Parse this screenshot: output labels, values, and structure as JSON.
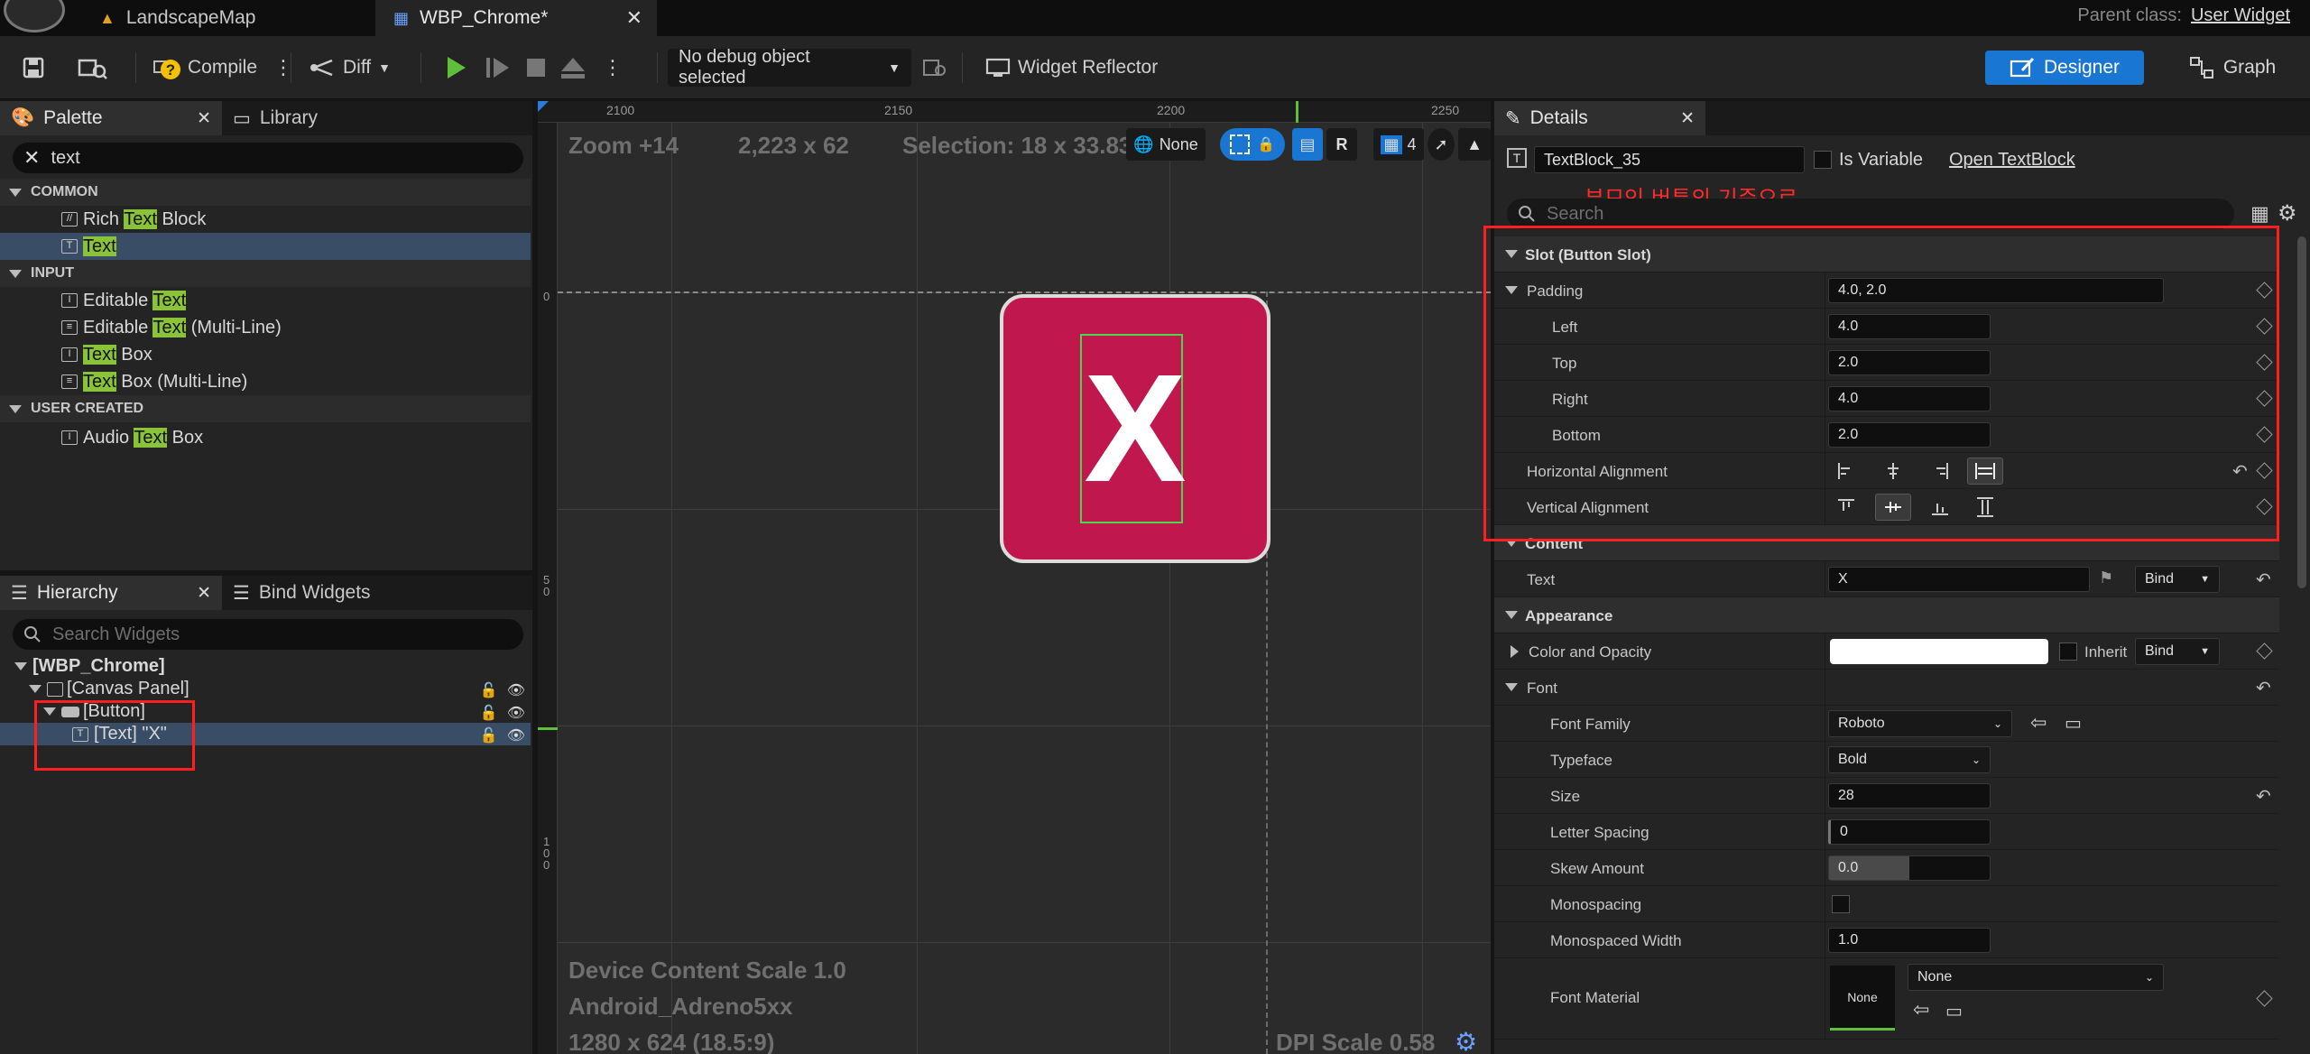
{
  "tabs": [
    {
      "label": "LandscapeMap",
      "active": false
    },
    {
      "label": "WBP_Chrome*",
      "active": true
    }
  ],
  "parent_class": {
    "label": "Parent class:",
    "value": "User Widget"
  },
  "toolbar": {
    "compile": "Compile",
    "diff": "Diff",
    "debug_object": "No debug object selected",
    "widget_reflector": "Widget Reflector",
    "designer": "Designer",
    "graph": "Graph"
  },
  "palette": {
    "tab_label": "Palette",
    "library_tab": "Library",
    "search_value": "text",
    "categories": [
      {
        "name": "COMMON",
        "items": [
          {
            "pre": "Rich ",
            "hl": "Text",
            "post": " Block",
            "selected": false
          },
          {
            "pre": "",
            "hl": "Text",
            "post": "",
            "selected": true
          }
        ]
      },
      {
        "name": "INPUT",
        "items": [
          {
            "pre": "Editable ",
            "hl": "Text",
            "post": ""
          },
          {
            "pre": "Editable ",
            "hl": "Text",
            "post": " (Multi-Line)"
          },
          {
            "pre": "",
            "hl": "Text",
            "post": " Box"
          },
          {
            "pre": "",
            "hl": "Text",
            "post": " Box (Multi-Line)"
          }
        ]
      },
      {
        "name": "USER CREATED",
        "items": [
          {
            "pre": "Audio ",
            "hl": "Text",
            "post": " Box"
          }
        ]
      }
    ]
  },
  "hierarchy": {
    "tab_label": "Hierarchy",
    "bind_tab": "Bind Widgets",
    "search_placeholder": "Search Widgets",
    "root": "[WBP_Chrome]",
    "canvas_panel": "[Canvas Panel]",
    "button": "[Button]",
    "text_item": "[Text] \"X\""
  },
  "canvas": {
    "zoom": "Zoom +14",
    "resolution": "2,223 x 62",
    "selection": "Selection: 18 x 33.83",
    "none_label": "None",
    "r_label": "R",
    "grid_count": "4",
    "ruler_h": [
      "2100",
      "2150",
      "2200",
      "2250"
    ],
    "ruler_v": [
      "0",
      "5\n0",
      "1\n0\n0"
    ],
    "button_text": "X",
    "device_scale": "Device Content Scale 1.0",
    "device_name": "Android_Adreno5xx",
    "device_res": "1280 x 624 (18.5:9)",
    "dpi_scale": "DPI Scale 0.58",
    "button_color": "#c0174e"
  },
  "details": {
    "tab_label": "Details",
    "widget_name": "TextBlock_35",
    "is_variable": "Is Variable",
    "open_link": "Open TextBlock",
    "annotation": "부모인 버튼의 기준으로",
    "search_placeholder": "Search",
    "slot_section": "Slot (Button Slot)",
    "padding": {
      "label": "Padding",
      "value": "4.0, 2.0"
    },
    "left": {
      "label": "Left",
      "value": "4.0"
    },
    "top": {
      "label": "Top",
      "value": "2.0"
    },
    "right": {
      "label": "Right",
      "value": "4.0"
    },
    "bottom": {
      "label": "Bottom",
      "value": "2.0"
    },
    "h_align": "Horizontal Alignment",
    "v_align": "Vertical Alignment",
    "content_section": "Content",
    "text": {
      "label": "Text",
      "value": "X",
      "bind": "Bind"
    },
    "appearance_section": "Appearance",
    "color_opacity": {
      "label": "Color and Opacity",
      "inherit": "Inherit",
      "bind": "Bind"
    },
    "font_section": "Font",
    "font_family": {
      "label": "Font Family",
      "value": "Roboto"
    },
    "typeface": {
      "label": "Typeface",
      "value": "Bold"
    },
    "size": {
      "label": "Size",
      "value": "28"
    },
    "letter_spacing": {
      "label": "Letter Spacing",
      "value": "0"
    },
    "skew_amount": {
      "label": "Skew Amount",
      "value": "0.0"
    },
    "monospacing": {
      "label": "Monospacing"
    },
    "mono_width": {
      "label": "Monospaced Width",
      "value": "1.0"
    },
    "font_material": {
      "label": "Font Material",
      "thumb": "None",
      "value": "None"
    }
  },
  "colors": {
    "accent_blue": "#1976d2",
    "highlight_green": "#8ac33a",
    "annotation_red": "#ff1f1f",
    "selection_blue": "#3a4d66"
  }
}
